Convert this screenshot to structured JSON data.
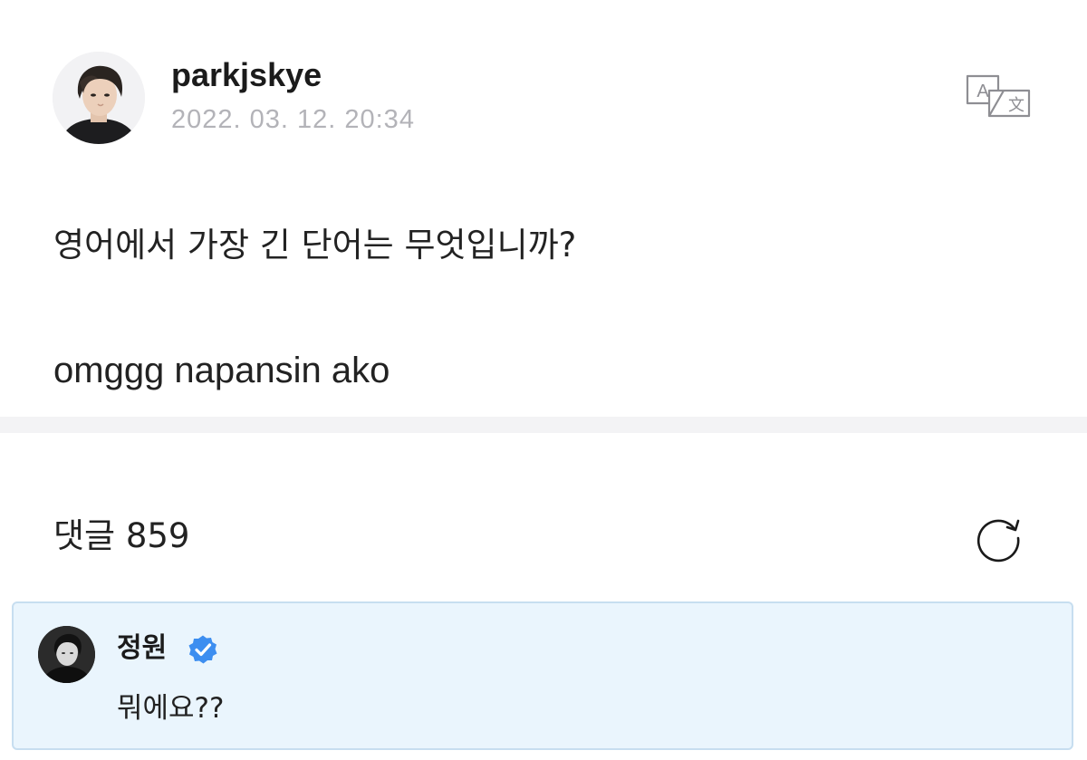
{
  "post": {
    "author": "parkjskye",
    "timestamp": "2022. 03. 12. 20:34",
    "question": "영어에서 가장 긴 단어는 무엇입니까?",
    "answer": "omggg napansin ako",
    "translate_icon": "translate-icon"
  },
  "comments": {
    "label": "댓글 859",
    "refresh_icon": "refresh-icon",
    "items": [
      {
        "author": "정원",
        "verified": true,
        "text": "뭐에요??",
        "highlight_color": "#eaf5fd",
        "badge_color": "#3d8ef0"
      }
    ]
  }
}
